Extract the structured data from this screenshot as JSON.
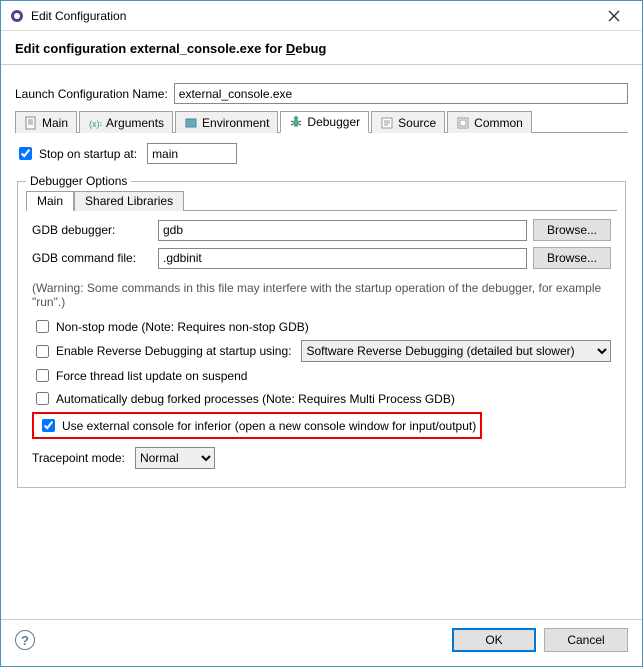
{
  "window": {
    "title": "Edit Configuration"
  },
  "header": {
    "title": "Edit configuration external_console.exe for Debug"
  },
  "launch": {
    "label": "Launch Configuration Name:",
    "value": "external_console.exe"
  },
  "tabs": {
    "main": "Main",
    "arguments": "Arguments",
    "environment": "Environment",
    "debugger": "Debugger",
    "source": "Source",
    "common": "Common"
  },
  "stopOn": {
    "label": "Stop on startup at:",
    "value": "main",
    "checked": true
  },
  "debuggerOptions": {
    "legend": "Debugger Options",
    "innerTabs": {
      "main": "Main",
      "shared": "Shared Libraries"
    },
    "gdbDebugger": {
      "label": "GDB debugger:",
      "value": "gdb",
      "browse": "Browse..."
    },
    "gdbCmdFile": {
      "label": "GDB command file:",
      "value": ".gdbinit",
      "browse": "Browse..."
    },
    "warning": "(Warning: Some commands in this file may interfere with the startup operation of the debugger, for example \"run\".)",
    "nonStop": "Non-stop mode (Note: Requires non-stop GDB)",
    "enableReverse": "Enable Reverse Debugging at startup using:",
    "reverseSelect": "Software Reverse Debugging (detailed but slower)",
    "forceThread": "Force thread list update on suspend",
    "autoForked": "Automatically debug forked processes (Note: Requires Multi Process GDB)",
    "externalConsole": "Use external console for inferior (open a new console window for input/output)",
    "tracepoint": {
      "label": "Tracepoint mode:",
      "value": "Normal"
    }
  },
  "footer": {
    "ok": "OK",
    "cancel": "Cancel"
  }
}
